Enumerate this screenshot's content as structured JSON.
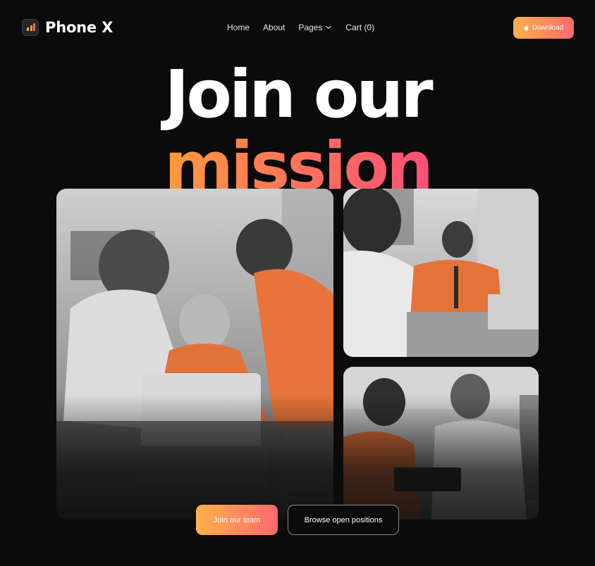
{
  "brand": {
    "name": "Phone X",
    "logo_icon": "bar-chart-logo-icon"
  },
  "nav": {
    "items": [
      {
        "label": "Home"
      },
      {
        "label": "About"
      },
      {
        "label": "Pages",
        "icon": "chevron-down-icon"
      },
      {
        "label": "Cart (0)"
      }
    ]
  },
  "header": {
    "download_label": "Download",
    "download_icon": "apple-icon"
  },
  "hero": {
    "line1": "Join our",
    "line2": "mission",
    "accent_gradient": [
      "#ff9a3c",
      "#ff4f78"
    ]
  },
  "photos": [
    {
      "desc_icon": "team-photo",
      "tint": "grayscale-orange"
    },
    {
      "desc_icon": "team-photo",
      "tint": "grayscale-orange"
    },
    {
      "desc_icon": "team-photo",
      "tint": "grayscale-orange"
    }
  ],
  "cta": {
    "primary_label": "Join our team",
    "secondary_label": "Browse open positions"
  },
  "colors": {
    "background": "#0b0b0c",
    "button_gradient_start": "#ffb14a",
    "button_gradient_end": "#ff6a6e",
    "accent_orange": "#e8743b"
  }
}
